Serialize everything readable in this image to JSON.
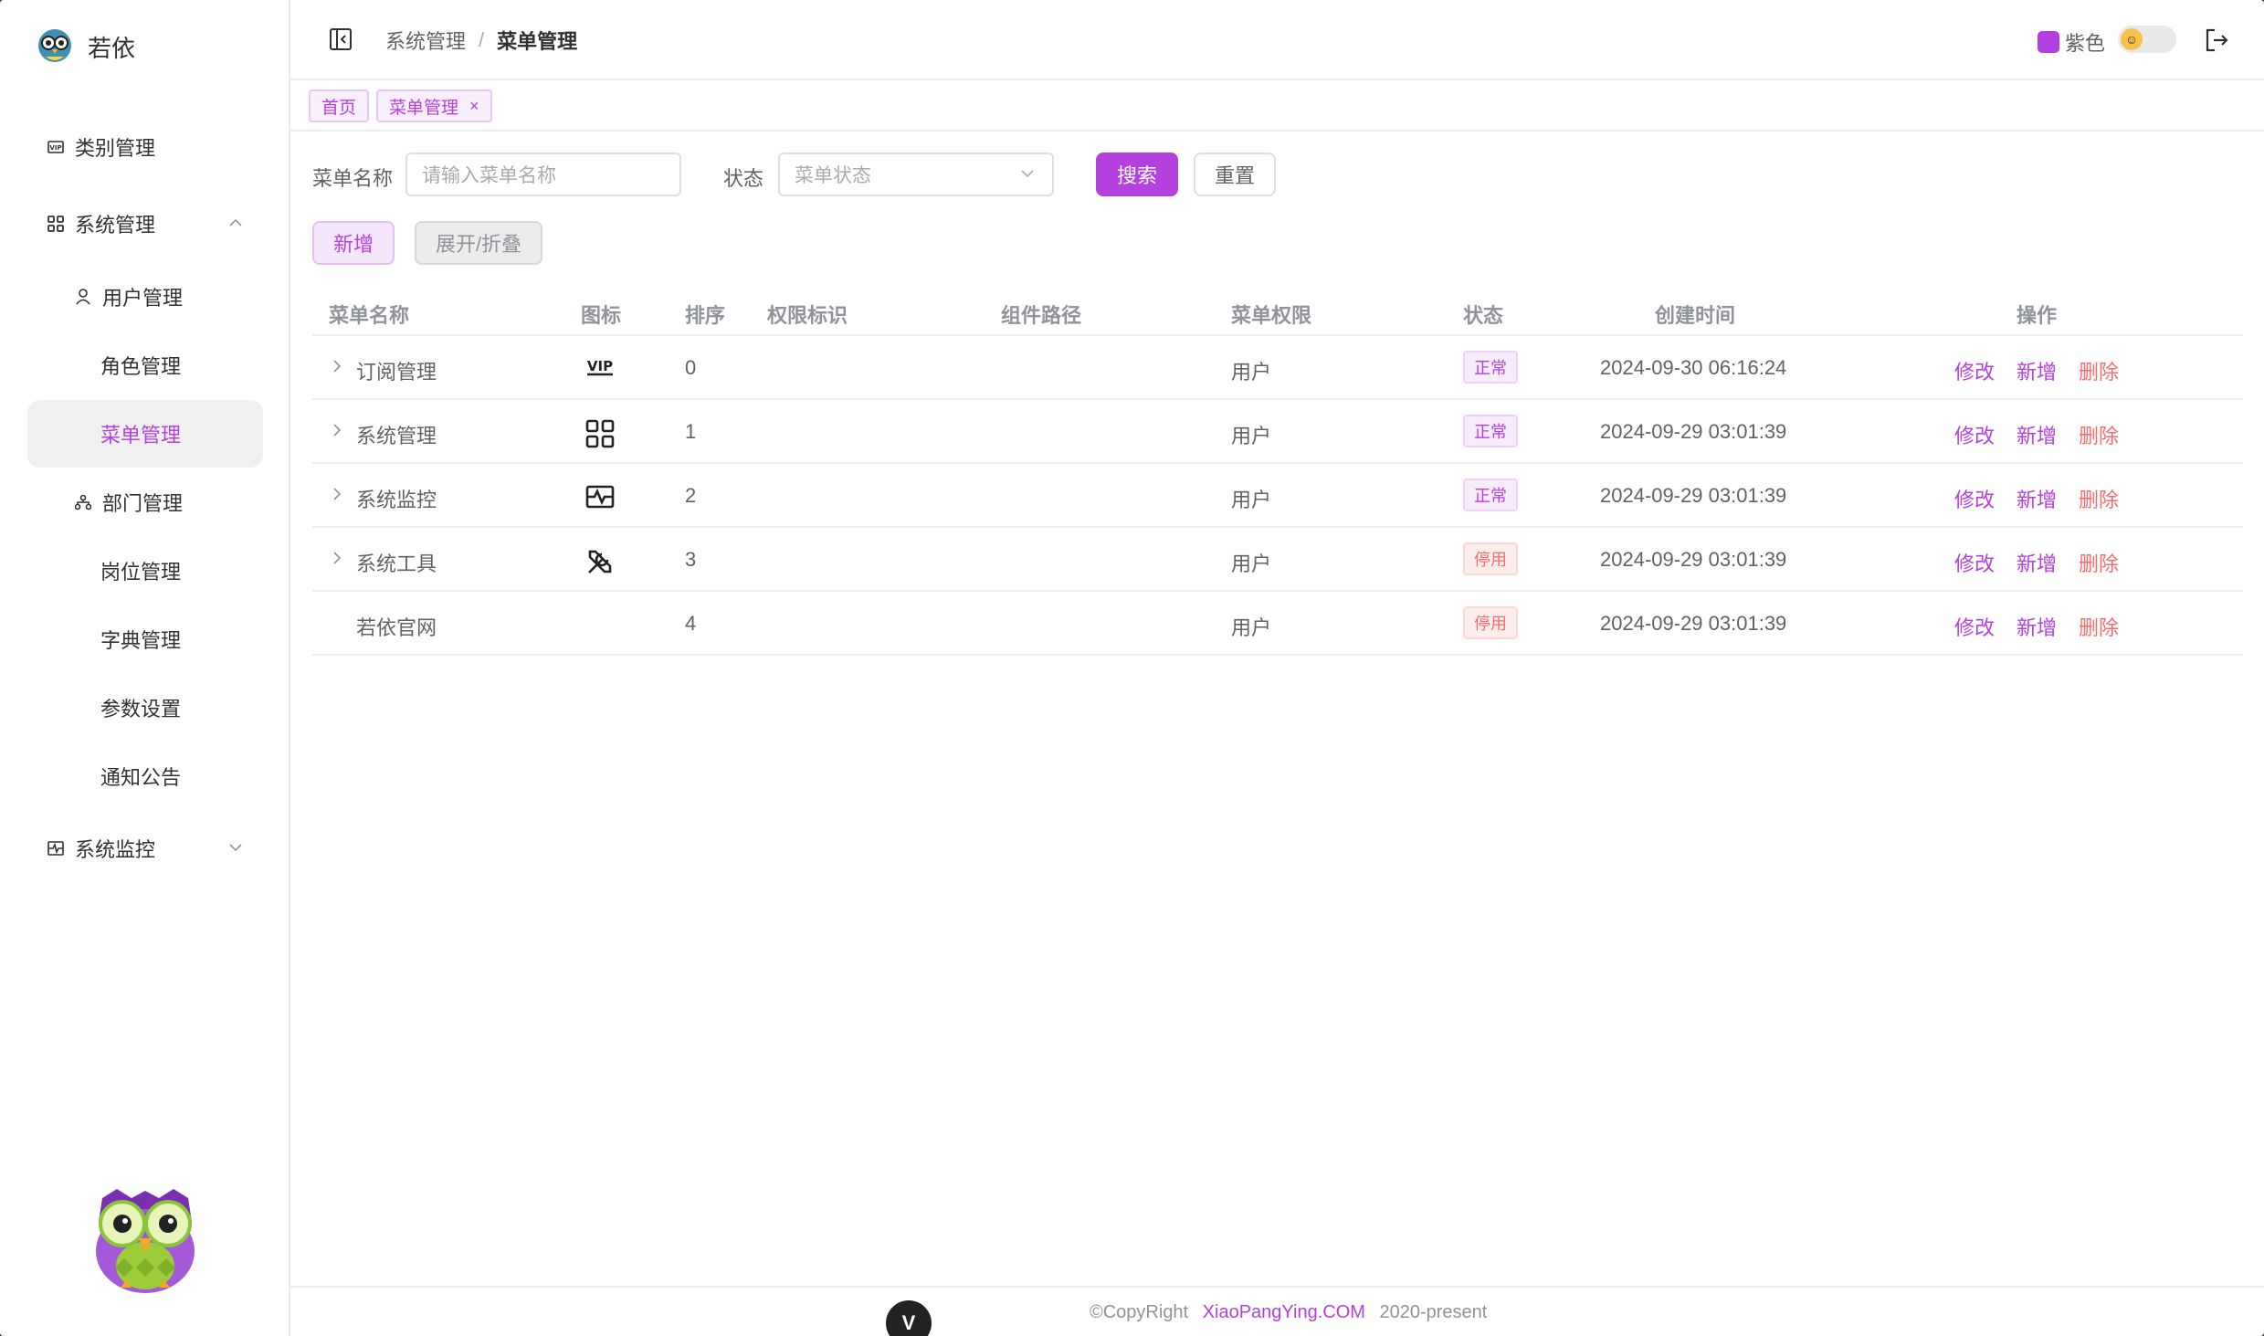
{
  "app": {
    "name": "若依"
  },
  "sidebar": {
    "items": [
      {
        "label": "类别管理",
        "icon": "vip-icon"
      },
      {
        "label": "系统管理",
        "icon": "apps-icon",
        "expanded": true
      },
      {
        "label": "用户管理",
        "icon": "user-icon"
      },
      {
        "label": "角色管理"
      },
      {
        "label": "菜单管理",
        "active": true
      },
      {
        "label": "部门管理",
        "icon": "tree-icon"
      },
      {
        "label": "岗位管理"
      },
      {
        "label": "字典管理"
      },
      {
        "label": "参数设置"
      },
      {
        "label": "通知公告"
      },
      {
        "label": "系统监控",
        "icon": "monitor-icon",
        "expanded": false
      }
    ]
  },
  "header": {
    "breadcrumb": [
      "系统管理",
      "菜单管理"
    ],
    "separator": "/",
    "theme_label": "紫色",
    "theme_color": "#b440e0"
  },
  "tags": [
    {
      "label": "首页"
    },
    {
      "label": "菜单管理",
      "close": "×"
    }
  ],
  "search": {
    "name_label": "菜单名称",
    "name_placeholder": "请输入菜单名称",
    "status_label": "状态",
    "status_placeholder": "菜单状态",
    "search_button": "搜索",
    "reset_button": "重置"
  },
  "toolbar": {
    "add_button": "新增",
    "expand_button": "展开/折叠"
  },
  "table": {
    "columns": [
      "菜单名称",
      "图标",
      "排序",
      "权限标识",
      "组件路径",
      "菜单权限",
      "状态",
      "创建时间",
      "操作"
    ],
    "rows": [
      {
        "name": "订阅管理",
        "icon": "vip-icon",
        "order": "0",
        "perm": "",
        "component": "",
        "menu_perm": "用户",
        "status": "正常",
        "created": "2024-09-30 06:16:24",
        "has_children": true
      },
      {
        "name": "系统管理",
        "icon": "apps-icon",
        "order": "1",
        "perm": "",
        "component": "",
        "menu_perm": "用户",
        "status": "正常",
        "created": "2024-09-29 03:01:39",
        "has_children": true
      },
      {
        "name": "系统监控",
        "icon": "monitor-icon",
        "order": "2",
        "perm": "",
        "component": "",
        "menu_perm": "用户",
        "status": "正常",
        "created": "2024-09-29 03:01:39",
        "has_children": true
      },
      {
        "name": "系统工具",
        "icon": "tools-icon",
        "order": "3",
        "perm": "",
        "component": "",
        "menu_perm": "用户",
        "status": "停用",
        "created": "2024-09-29 03:01:39",
        "has_children": true
      },
      {
        "name": "若依官网",
        "icon": "",
        "order": "4",
        "perm": "",
        "component": "",
        "menu_perm": "用户",
        "status": "停用",
        "created": "2024-09-29 03:01:39",
        "has_children": false
      }
    ],
    "actions": {
      "edit": "修改",
      "add": "新增",
      "delete": "删除"
    }
  },
  "footer": {
    "copyright": "©CopyRight",
    "site": "XiaoPangYing.COM",
    "years": "2020-present",
    "badge": "V"
  },
  "colors": {
    "accent": "#b440e0",
    "danger": "#f56c6c"
  }
}
